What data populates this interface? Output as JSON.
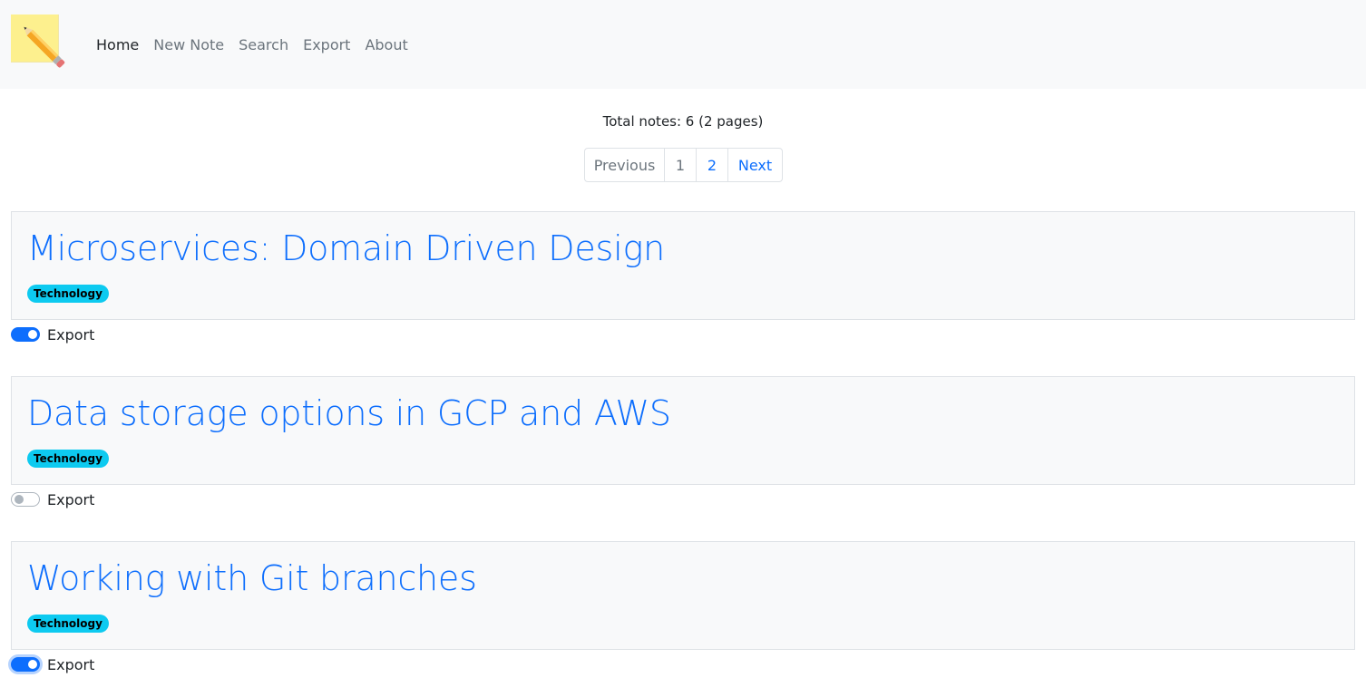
{
  "nav": {
    "items": [
      {
        "label": "Home",
        "active": true
      },
      {
        "label": "New Note",
        "active": false
      },
      {
        "label": "Search",
        "active": false
      },
      {
        "label": "Export",
        "active": false
      },
      {
        "label": "About",
        "active": false
      }
    ]
  },
  "summary": "Total notes: 6 (2 pages)",
  "pagination": {
    "previous": "Previous",
    "pages": [
      "1",
      "2"
    ],
    "next": "Next",
    "current_page": 1
  },
  "notes": [
    {
      "title": "Microservices: Domain Driven Design",
      "tag": "Technology",
      "export_label": "Export",
      "export_enabled": true
    },
    {
      "title": "Data storage options in GCP and AWS",
      "tag": "Technology",
      "export_label": "Export",
      "export_enabled": false
    },
    {
      "title": "Working with Git branches",
      "tag": "Technology",
      "export_label": "Export",
      "export_enabled": true
    }
  ],
  "colors": {
    "link": "#0d6efd",
    "badge": "#0dcaf0",
    "navbar_bg": "#f8f9fa"
  }
}
